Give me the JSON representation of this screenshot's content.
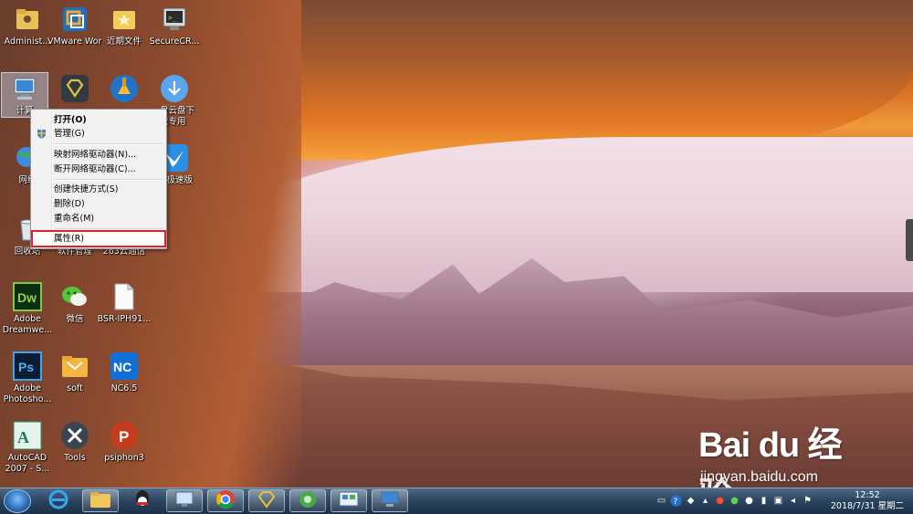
{
  "desktop": {
    "icons": [
      {
        "label": "Administ...",
        "icon": "folder-user-icon"
      },
      {
        "label": "VMware Workstati...",
        "icon": "vmware-icon"
      },
      {
        "label": "近期文件",
        "icon": "folder-star-icon"
      },
      {
        "label": "SecureCR...",
        "icon": "securecrt-icon"
      },
      {
        "label": "计算",
        "icon": "computer-icon"
      },
      {
        "label": "",
        "icon": "diamond-app-icon"
      },
      {
        "label": "",
        "icon": "cleaner-icon"
      },
      {
        "label": "盘云盘下 载专用",
        "icon": "download-icon"
      },
      {
        "label": "网络",
        "icon": "network-icon"
      },
      {
        "label": "雷极速版",
        "icon": "thunder-icon"
      },
      {
        "label": "回收站",
        "icon": "recycle-bin-icon"
      },
      {
        "label": "软件管理",
        "icon": "software-manager-icon"
      },
      {
        "label": "263云通信",
        "icon": "cloud-communication-icon"
      },
      {
        "label": "Adobe Dreamwe...",
        "icon": "dreamweaver-icon"
      },
      {
        "label": "微信",
        "icon": "wechat-icon"
      },
      {
        "label": "BSR-IPH91...",
        "icon": "file-icon"
      },
      {
        "label": "Adobe Photosho...",
        "icon": "photoshop-icon"
      },
      {
        "label": "soft",
        "icon": "folder-soft-icon"
      },
      {
        "label": "NC6.5",
        "icon": "nc-icon"
      },
      {
        "label": "AutoCAD 2007 - S...",
        "icon": "autocad-icon"
      },
      {
        "label": "Tools",
        "icon": "tools-icon"
      },
      {
        "label": "psiphon3",
        "icon": "psiphon-icon"
      }
    ]
  },
  "context_menu": {
    "items": [
      {
        "label": "打开(O)",
        "bold": true
      },
      {
        "label": "管理(G)",
        "icon": "shield-icon"
      },
      {
        "label": "映射网络驱动器(N)..."
      },
      {
        "label": "断开网络驱动器(C)..."
      },
      {
        "label": "创建快捷方式(S)"
      },
      {
        "label": "删除(D)"
      },
      {
        "label": "重命名(M)"
      },
      {
        "label": "属性(R)",
        "highlighted": true
      }
    ],
    "highlight_color": "#e0202a"
  },
  "taskbar": {
    "start_icon": "windows-start-icon",
    "pinned": [
      "ie-icon",
      "explorer-icon",
      "qq-icon",
      "remote-desktop-icon",
      "chrome-icon",
      "diamond-app-icon",
      "green-app-icon",
      "control-panel-icon",
      "computer-icon"
    ],
    "tray_icons": [
      "keyboard-icon",
      "help-icon",
      "network-status-icon",
      "weibo-icon",
      "wechat-icon",
      "qq-icon",
      "battery-icon",
      "display-icon",
      "volume-icon",
      "flag-icon"
    ],
    "clock": {
      "time": "12:52",
      "date": "2018/7/31 星期二"
    }
  },
  "watermark": {
    "logo": "Bai du 经验",
    "site": "jingyan.baidu.com"
  }
}
